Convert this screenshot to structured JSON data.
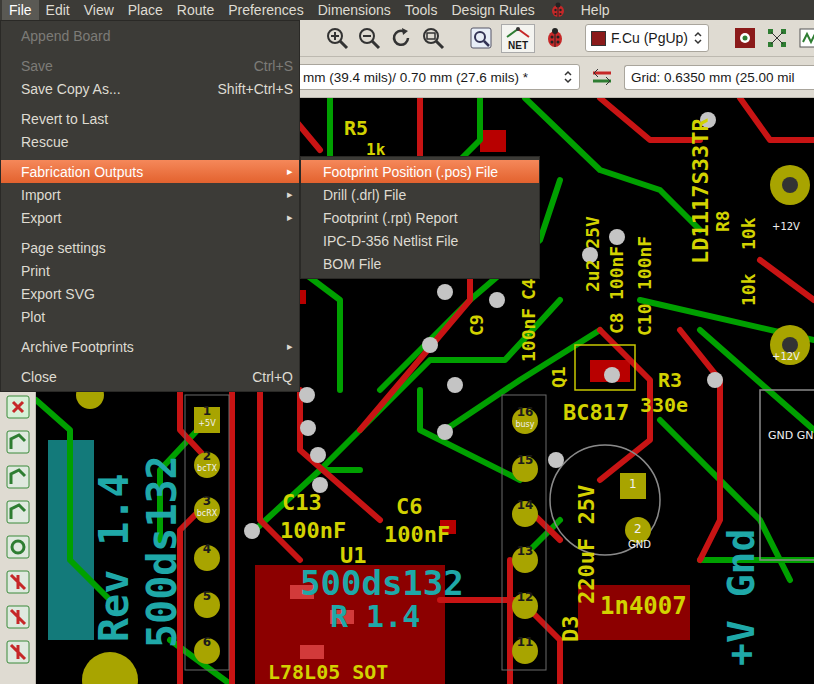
{
  "menubar": [
    {
      "kind": "text",
      "label": "File",
      "selected": true
    },
    {
      "kind": "text",
      "label": "Edit",
      "selected": false
    },
    {
      "kind": "text",
      "label": "View",
      "selected": false
    },
    {
      "kind": "text",
      "label": "Place",
      "selected": false
    },
    {
      "kind": "text",
      "label": "Route",
      "selected": false
    },
    {
      "kind": "text",
      "label": "Preferences",
      "selected": false
    },
    {
      "kind": "text",
      "label": "Dimensions",
      "selected": false
    },
    {
      "kind": "text",
      "label": "Tools",
      "selected": false
    },
    {
      "kind": "text",
      "label": "Design Rules",
      "selected": false
    },
    {
      "kind": "icon",
      "selected": false
    },
    {
      "kind": "text",
      "label": "Help",
      "selected": false
    }
  ],
  "submenu_arrow": "▸",
  "file_menu": [
    {
      "kind": "item",
      "label": "Append Board",
      "disabled": true,
      "has_submenu": false,
      "selected": false
    },
    {
      "kind": "separator"
    },
    {
      "kind": "item",
      "label": "Save",
      "shortcut": "Ctrl+S",
      "disabled": true,
      "has_submenu": false,
      "selected": false
    },
    {
      "kind": "item",
      "label": "Save Copy As...",
      "shortcut": "Shift+Ctrl+S",
      "disabled": false,
      "has_submenu": false,
      "selected": false
    },
    {
      "kind": "separator"
    },
    {
      "kind": "item",
      "label": "Revert to Last",
      "disabled": false,
      "has_submenu": false,
      "selected": false
    },
    {
      "kind": "item",
      "label": "Rescue",
      "disabled": false,
      "has_submenu": false,
      "selected": false
    },
    {
      "kind": "separator"
    },
    {
      "kind": "item",
      "label": "Fabrication Outputs",
      "disabled": false,
      "has_submenu": true,
      "selected": true
    },
    {
      "kind": "item",
      "label": "Import",
      "disabled": false,
      "has_submenu": true,
      "selected": false
    },
    {
      "kind": "item",
      "label": "Export",
      "disabled": false,
      "has_submenu": true,
      "selected": false
    },
    {
      "kind": "separator"
    },
    {
      "kind": "item",
      "label": "Page settings",
      "disabled": false,
      "has_submenu": false,
      "selected": false
    },
    {
      "kind": "item",
      "label": "Print",
      "disabled": false,
      "has_submenu": false,
      "selected": false
    },
    {
      "kind": "item",
      "label": "Export SVG",
      "disabled": false,
      "has_submenu": false,
      "selected": false
    },
    {
      "kind": "item",
      "label": "Plot",
      "disabled": false,
      "has_submenu": false,
      "selected": false
    },
    {
      "kind": "separator"
    },
    {
      "kind": "item",
      "label": "Archive Footprints",
      "disabled": false,
      "has_submenu": true,
      "selected": false
    },
    {
      "kind": "separator"
    },
    {
      "kind": "item",
      "label": "Close",
      "shortcut": "Ctrl+Q",
      "disabled": false,
      "has_submenu": false,
      "selected": false
    }
  ],
  "fabrication_submenu": [
    {
      "label": "Footprint Position (.pos) File",
      "selected": true
    },
    {
      "label": "Drill (.drl) File",
      "selected": false
    },
    {
      "label": "Footprint (.rpt) Report",
      "selected": false
    },
    {
      "label": "IPC-D-356 Netlist File",
      "selected": false
    },
    {
      "label": "BOM File",
      "selected": false
    }
  ],
  "toolbar": {
    "net_icon_label": "NET",
    "layer": {
      "label": "F.Cu (PgUp)",
      "color": "#8b1a1a"
    },
    "track_width": "mm (39.4 mils)/ 0.70 mm (27.6 mils) *",
    "grid": "Grid: 0.6350 mm (25.00 mil"
  },
  "canvas": {
    "texts": [
      {
        "text": "R5",
        "kind": "front"
      },
      {
        "text": "1k",
        "kind": "front"
      },
      {
        "text": "LD1117S33TR",
        "kind": "front"
      },
      {
        "text": "R8",
        "kind": "front"
      },
      {
        "text": "10k",
        "kind": "front"
      },
      {
        "text": "10k",
        "kind": "front"
      },
      {
        "text": "C4",
        "kind": "front"
      },
      {
        "text": "100nF",
        "kind": "front"
      },
      {
        "text": "C9",
        "kind": "front"
      },
      {
        "text": "2u2 25V",
        "kind": "front"
      },
      {
        "text": "100nF",
        "kind": "front"
      },
      {
        "text": "C8",
        "kind": "front"
      },
      {
        "text": "100nF",
        "kind": "front"
      },
      {
        "text": "C10",
        "kind": "front"
      },
      {
        "text": "Q1",
        "kind": "front"
      },
      {
        "text": "BC817",
        "kind": "front"
      },
      {
        "text": "R3",
        "kind": "front"
      },
      {
        "text": "330e",
        "kind": "front"
      },
      {
        "text": "C13",
        "kind": "front"
      },
      {
        "text": "100nF",
        "kind": "front"
      },
      {
        "text": "C6",
        "kind": "front"
      },
      {
        "text": "100nF",
        "kind": "front"
      },
      {
        "text": "U1",
        "kind": "front"
      },
      {
        "text": "500ds132",
        "kind": "back"
      },
      {
        "text": "Rev 1.4",
        "kind": "back"
      },
      {
        "text": "500ds132",
        "kind": "back"
      },
      {
        "text": "R 1.4",
        "kind": "back"
      },
      {
        "text": "D3",
        "kind": "front"
      },
      {
        "text": "220uF 25V",
        "kind": "front"
      },
      {
        "text": "1n4007",
        "kind": "front"
      },
      {
        "text": "+V Gnd",
        "kind": "back"
      },
      {
        "text": "L78L05 SOT",
        "kind": "front"
      },
      {
        "text": "GND GN",
        "kind": "pad"
      },
      {
        "text": "+12V",
        "kind": "pad"
      },
      {
        "text": "+12V",
        "kind": "pad"
      },
      {
        "text": "GND",
        "kind": "pad"
      },
      {
        "text": "1",
        "kind": "pad"
      },
      {
        "text": "2",
        "kind": "pad"
      }
    ],
    "header_left": [
      {
        "number": "1",
        "net": "+5V"
      },
      {
        "number": "2",
        "net": "bcTX"
      },
      {
        "number": "3",
        "net": "bcRX"
      },
      {
        "number": "4"
      },
      {
        "number": "5"
      },
      {
        "number": "6"
      }
    ],
    "header_right": [
      {
        "number": "16",
        "net": "busy"
      },
      {
        "number": "15"
      },
      {
        "number": "14"
      },
      {
        "number": "13"
      },
      {
        "number": "12"
      },
      {
        "number": "11"
      }
    ]
  }
}
